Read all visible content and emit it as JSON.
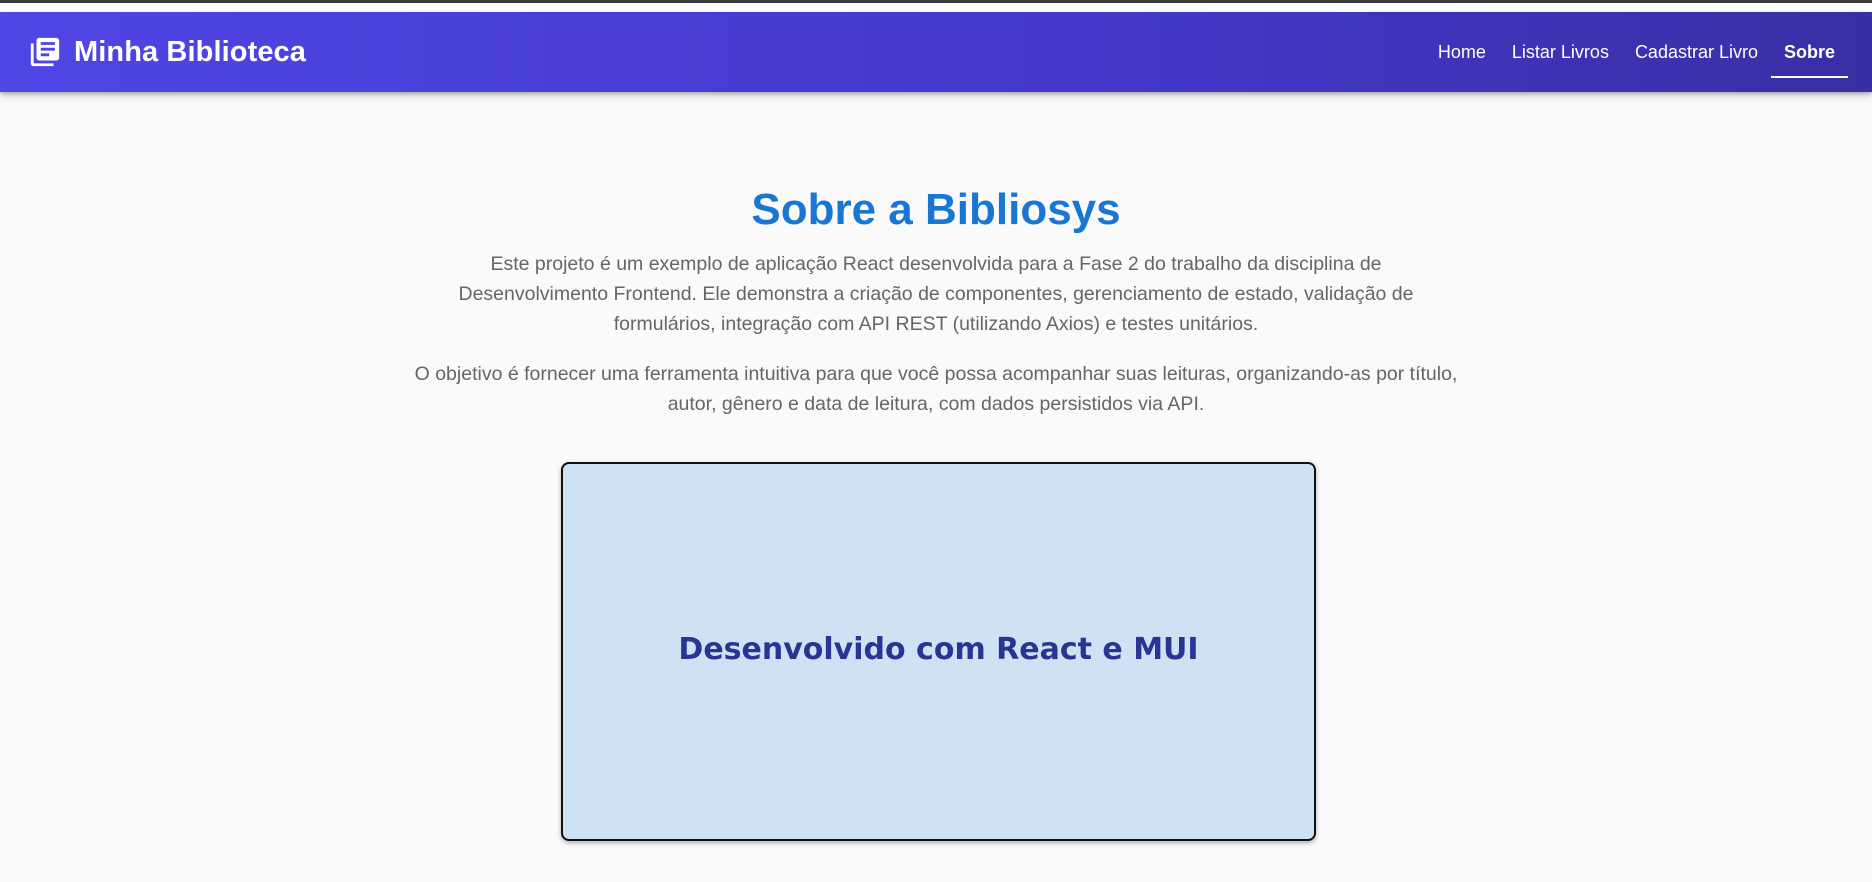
{
  "header": {
    "brand_icon": "library-books-icon",
    "title": "Minha Biblioteca",
    "nav": [
      {
        "label": "Home",
        "active": false
      },
      {
        "label": "Listar Livros",
        "active": false
      },
      {
        "label": "Cadastrar Livro",
        "active": false
      },
      {
        "label": "Sobre",
        "active": true
      }
    ]
  },
  "main": {
    "title": "Sobre a Bibliosys",
    "paragraph1": "Este projeto é um exemplo de aplicação React desenvolvida para a Fase 2 do trabalho da disciplina de Desenvolvimento Frontend. Ele demonstra a criação de componentes, gerenciamento de estado, validação de formulários, integração com API REST (utilizando Axios) e testes unitários.",
    "paragraph2": "O objetivo é fornecer uma ferramenta intuitiva para que você possa acompanhar suas leituras, organizando-as por título, autor, gênero e data de leitura, com dados persistidos via API.",
    "card_text": "Desenvolvido com React e MUI"
  },
  "colors": {
    "appbar_start": "#4f46e5",
    "appbar_end": "#3730a3",
    "title": "#1976d2",
    "card_background": "#cfe2f3",
    "card_text": "#283593",
    "body_text": "#666666"
  }
}
